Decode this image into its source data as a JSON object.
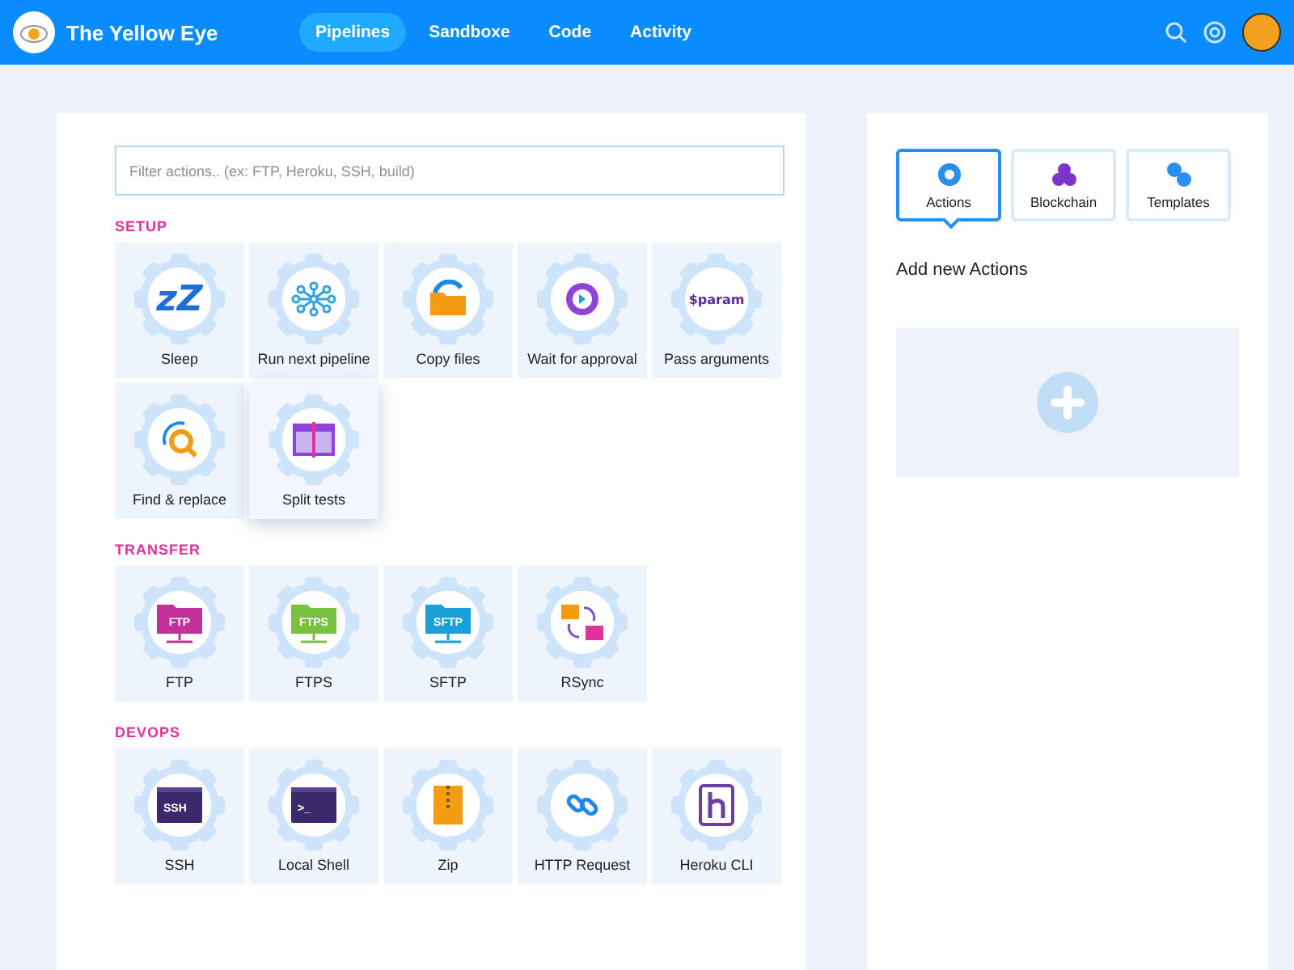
{
  "header": {
    "brand": "The Yellow Eye",
    "nav": [
      {
        "label": "Pipelines",
        "selected": true
      },
      {
        "label": "Sandboxe",
        "selected": false
      },
      {
        "label": "Code",
        "selected": false
      },
      {
        "label": "Activity",
        "selected": false
      }
    ]
  },
  "filter": {
    "placeholder": "Filter actions.. (ex: FTP, Heroku, SSH, build)"
  },
  "sections": [
    {
      "title": "SETUP",
      "actions": [
        {
          "label": "Sleep",
          "kind": "sleep",
          "icon_text": "zZ",
          "hovered": false
        },
        {
          "label": "Run next pipeline",
          "kind": "pipeline",
          "hovered": false
        },
        {
          "label": "Copy files",
          "kind": "copy",
          "hovered": false
        },
        {
          "label": "Wait for approval",
          "kind": "approval",
          "hovered": false
        },
        {
          "label": "Pass arguments",
          "kind": "param",
          "icon_text": "$param",
          "hovered": false
        },
        {
          "label": "Find & replace",
          "kind": "find",
          "hovered": false
        },
        {
          "label": "Split tests",
          "kind": "split",
          "hovered": true
        }
      ]
    },
    {
      "title": "TRANSFER",
      "actions": [
        {
          "label": "FTP",
          "kind": "folder",
          "icon_text": "FTP",
          "hovered": false
        },
        {
          "label": "FTPS",
          "kind": "folder",
          "icon_text": "FTPS",
          "hovered": false
        },
        {
          "label": "SFTP",
          "kind": "folder",
          "icon_text": "SFTP",
          "hovered": false
        },
        {
          "label": "RSync",
          "kind": "rsync",
          "hovered": false
        }
      ]
    },
    {
      "title": "DEVOPS",
      "actions": [
        {
          "label": "SSH",
          "kind": "terminal",
          "icon_text": "SSH",
          "hovered": false
        },
        {
          "label": "Local Shell",
          "kind": "terminal",
          "icon_text": ">_",
          "hovered": false
        },
        {
          "label": "Zip",
          "kind": "zip",
          "hovered": false
        },
        {
          "label": "HTTP Request",
          "kind": "link",
          "hovered": false
        },
        {
          "label": "Heroku CLI",
          "kind": "heroku",
          "hovered": false
        }
      ]
    }
  ],
  "side": {
    "tabs": [
      {
        "label": "Actions",
        "kind": "actions",
        "selected": true
      },
      {
        "label": "Blockchain",
        "kind": "blockchain",
        "selected": false
      },
      {
        "label": "Templates",
        "kind": "templates",
        "selected": false
      }
    ],
    "heading": "Add new Actions"
  }
}
